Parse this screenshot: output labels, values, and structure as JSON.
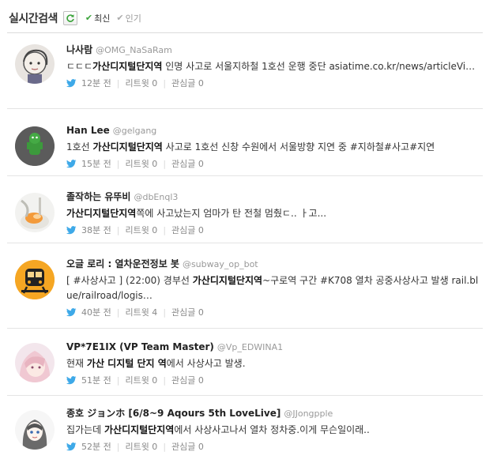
{
  "header": {
    "title": "실시간검색",
    "sort_latest": "최신",
    "sort_popular": "인기"
  },
  "tweets": [
    {
      "name": "나사람",
      "handle": "@OMG_NaSaRam",
      "segments": [
        {
          "t": "ㄷㄷㄷ"
        },
        {
          "t": "가산디지털단지역",
          "b": true
        },
        {
          "t": " 인명 사고로 서울지하철 1호선 운행 중단 "
        },
        {
          "t": "asiatime.co.kr/news/articleVi…",
          "link": true
        }
      ],
      "time": "12분 전",
      "retweets": "리트윗 0",
      "favorites": "관심글 0"
    },
    {
      "name": "Han Lee",
      "handle": "@gelgang",
      "segments": [
        {
          "t": "1호선 "
        },
        {
          "t": "가산디지털단지역",
          "b": true
        },
        {
          "t": " 사고로 1호선 신창 수원에서 서울방향 지연 중 "
        },
        {
          "t": "#지하철",
          "tag": true
        },
        {
          "t": "#사고",
          "tag": true
        },
        {
          "t": "#지연",
          "tag": true
        }
      ],
      "time": "15분 전",
      "retweets": "리트윗 0",
      "favorites": "관심글 0"
    },
    {
      "name": "졸작하는 유뚜비",
      "handle": "@dbEnql3",
      "segments": [
        {
          "t": "가산디지털단지역",
          "b": true
        },
        {
          "t": "쪽에 사고났는지 엄마가 탄 전철 멈췄ㄷ.. ㅏ고..."
        }
      ],
      "time": "38분 전",
      "retweets": "리트윗 0",
      "favorites": "관심글 0"
    },
    {
      "name": "오글 로리 : 열차운전정보 봇",
      "handle": "@subway_op_bot",
      "segments": [
        {
          "t": "[ "
        },
        {
          "t": "#사상사고",
          "tag": true
        },
        {
          "t": " ] (22:00) 경부선 "
        },
        {
          "t": "가산디지털단지역",
          "b": true
        },
        {
          "t": "~구로역 구간 "
        },
        {
          "t": "#K708",
          "tag": true
        },
        {
          "t": " 열차 공중사상사고 발생 "
        },
        {
          "t": "rail.blue/railroad/logis…",
          "link": true
        }
      ],
      "time": "40분 전",
      "retweets": "리트윗 4",
      "favorites": "관심글 0"
    },
    {
      "name": "VP*7E1IX (VP Team Master)",
      "handle": "@Vp_EDWINA1",
      "segments": [
        {
          "t": "현재 "
        },
        {
          "t": "가산 디지털 단지 역",
          "b": true
        },
        {
          "t": "에서 사상사고 발생."
        }
      ],
      "time": "51분 전",
      "retweets": "리트윗 0",
      "favorites": "관심글 0"
    },
    {
      "name": "종호 ジョンホ [6/8~9 Aqours 5th LoveLive]",
      "handle": "@JJongpple",
      "segments": [
        {
          "t": "집가는데 "
        },
        {
          "t": "가산디지털단지역",
          "b": true
        },
        {
          "t": "에서 사상사고나서 열차 정차중.이게 무슨일이래.."
        }
      ],
      "time": "52분 전",
      "retweets": "리트윗 0",
      "favorites": "관심글 0"
    }
  ],
  "colors": {
    "twitter_bird": "#3ea9e8",
    "check_green": "#3aa33a",
    "divider": "#e4e4e4"
  },
  "icons": [
    "refresh-icon",
    "check-icon",
    "twitter-bird-icon"
  ]
}
